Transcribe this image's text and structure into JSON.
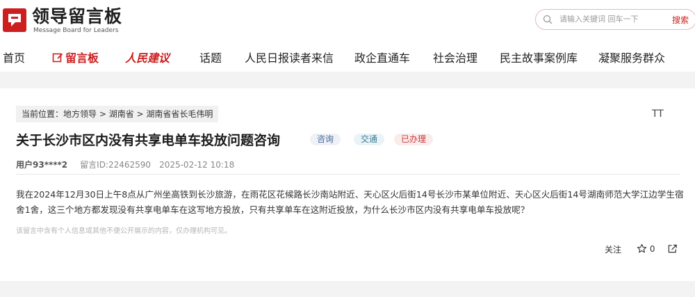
{
  "logo": {
    "title": "领导留言板",
    "subtitle": "Message Board for Leaders"
  },
  "search": {
    "placeholder": "请输入关键词 回车一下",
    "button": "搜索"
  },
  "nav": {
    "home": "首页",
    "liuyanban": "留言板",
    "renminjianyi": "人民建议",
    "huati": "话题",
    "rmrb_duzhe": "人民日报读者来信",
    "zhengqi": "政企直通车",
    "shehui": "社会治理",
    "minzhu": "民主故事案例库",
    "ningju": "凝聚服务群众"
  },
  "breadcrumb": {
    "prefix": "当前位置：",
    "level1": "地方领导",
    "sep": " > ",
    "level2": "湖南省",
    "level3": "湖南省省长毛伟明"
  },
  "font_tool": "TT",
  "message": {
    "title": "关于长沙市区内没有共享电单车投放问题咨询",
    "tags": [
      "咨询",
      "交通",
      "已办理"
    ],
    "user": "用户93****2",
    "id": "留言ID:22462590",
    "date": "2025-02-12 10:18",
    "content": "我在2024年12月30日上午8点从广州坐高铁到长沙旅游，在雨花区花候路长沙南站附近、天心区火后街14号长沙市某单位附近、天心区火后街14号湖南师范大学江边学生宿舍1舍，这三个地方都发现没有共享电单车在这写地方投放，只有共享单车在这附近投放，为什么长沙市区内没有共享电单车投放呢？",
    "note": "该留言中含有个人信息或其他不便公开展示的内容，仅办理机构可见。"
  },
  "actions": {
    "follow": "关注",
    "like_count": "0"
  },
  "colors": {
    "brand_red": "#cc1f1f"
  }
}
